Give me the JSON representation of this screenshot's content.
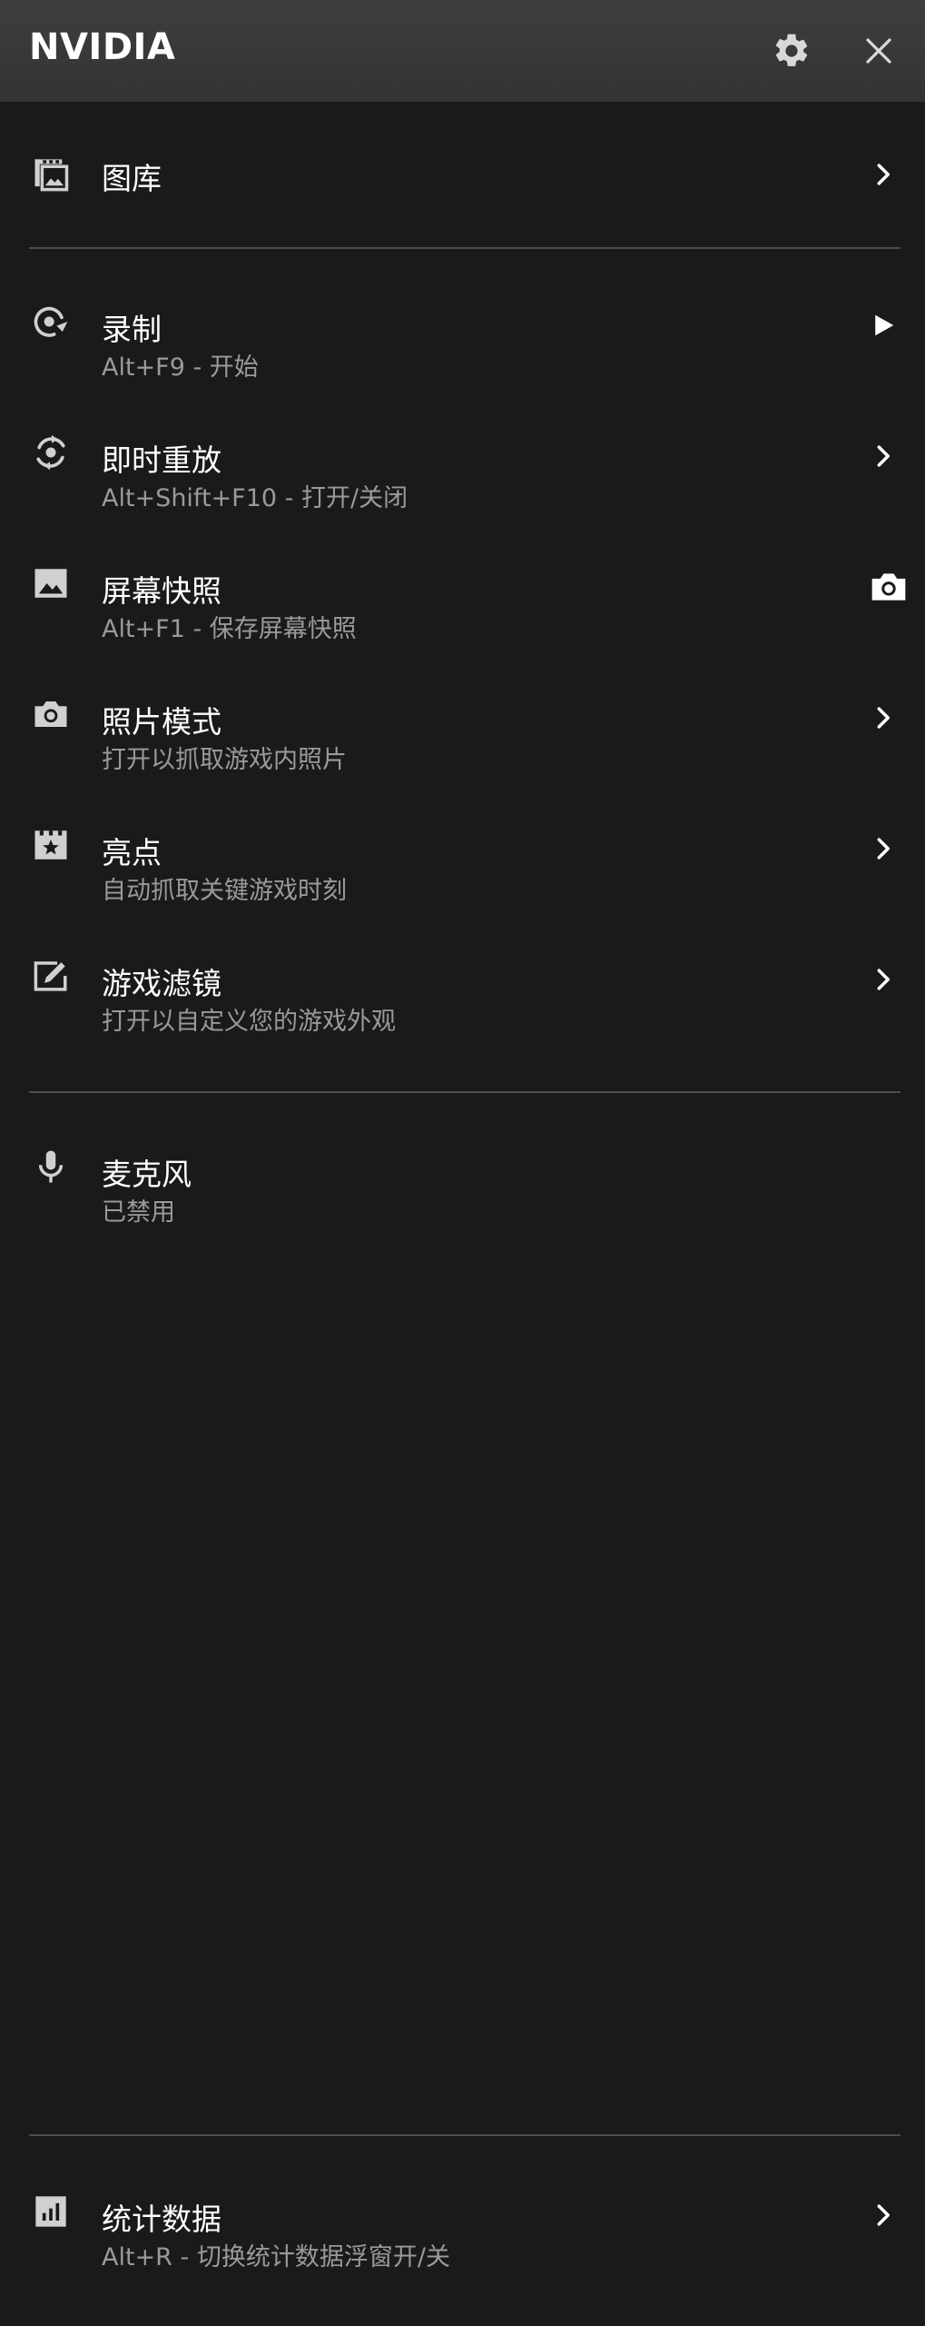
{
  "header": {
    "brand": "NVIDIA",
    "settings_icon": "gear-icon",
    "close_icon": "close-icon",
    "background": "#3a3a3a"
  },
  "menu": {
    "gallery": {
      "icon": "gallery-icon",
      "label": "图库",
      "action_icon": "chevron-right-icon"
    },
    "record": {
      "icon": "record-icon",
      "label": "录制",
      "hint": "Alt+F9 - 开始",
      "action_icon": "play-icon"
    },
    "instant_replay": {
      "icon": "instant-replay-icon",
      "label": "即时重放",
      "hint": "Alt+Shift+F10 - 打开/关闭",
      "action_icon": "chevron-right-icon"
    },
    "screenshot": {
      "icon": "image-icon",
      "label": "屏幕快照",
      "hint": "Alt+F1 - 保存屏幕快照",
      "action_icon": "camera-icon"
    },
    "photo_mode": {
      "icon": "camera-icon",
      "label": "照片模式",
      "hint": "打开以抓取游戏内照片",
      "action_icon": "chevron-right-icon"
    },
    "highlights": {
      "icon": "highlights-icon",
      "label": "亮点",
      "hint": "自动抓取关键游戏时刻",
      "action_icon": "chevron-right-icon"
    },
    "game_filter": {
      "icon": "filter-edit-icon",
      "label": "游戏滤镜",
      "hint": "打开以自定义您的游戏外观",
      "action_icon": "chevron-right-icon"
    },
    "microphone": {
      "icon": "microphone-icon",
      "label": "麦克风",
      "hint": "已禁用"
    },
    "statistics": {
      "icon": "statistics-icon",
      "label": "统计数据",
      "hint": "Alt+R - 切换统计数据浮窗开/关",
      "action_icon": "chevron-right-icon"
    }
  },
  "colors": {
    "background": "#1a1a1a",
    "divider": "#4d4d4d",
    "text_primary": "#ffffff",
    "text_secondary": "#9a9a9a",
    "icon": "#d0d0d0"
  }
}
